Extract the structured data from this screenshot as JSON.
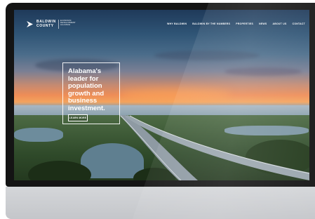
{
  "logo": {
    "line1": "BALDWIN",
    "line2": "COUNTY",
    "tagline": "Economic Development Alliance",
    "icon": "baldwin-county-logo-mark"
  },
  "nav": {
    "items": [
      {
        "label": "WHY BALDWIN"
      },
      {
        "label": "BALDWIN BY THE NUMBERS"
      },
      {
        "label": "PROPERTIES"
      },
      {
        "label": "NEWS"
      },
      {
        "label": "ABOUT US"
      },
      {
        "label": "CONTACT"
      }
    ]
  },
  "hero": {
    "title_lines": [
      "Alabama's",
      "leader for",
      "population",
      "growth and",
      "business",
      "investment."
    ],
    "button_label": "LEARN MORE"
  },
  "colors": {
    "monitor_bezel": "#141414",
    "monitor_chin": "#c9cbcf",
    "text": "#ffffff",
    "sunset_accent": "#ee8d57"
  }
}
